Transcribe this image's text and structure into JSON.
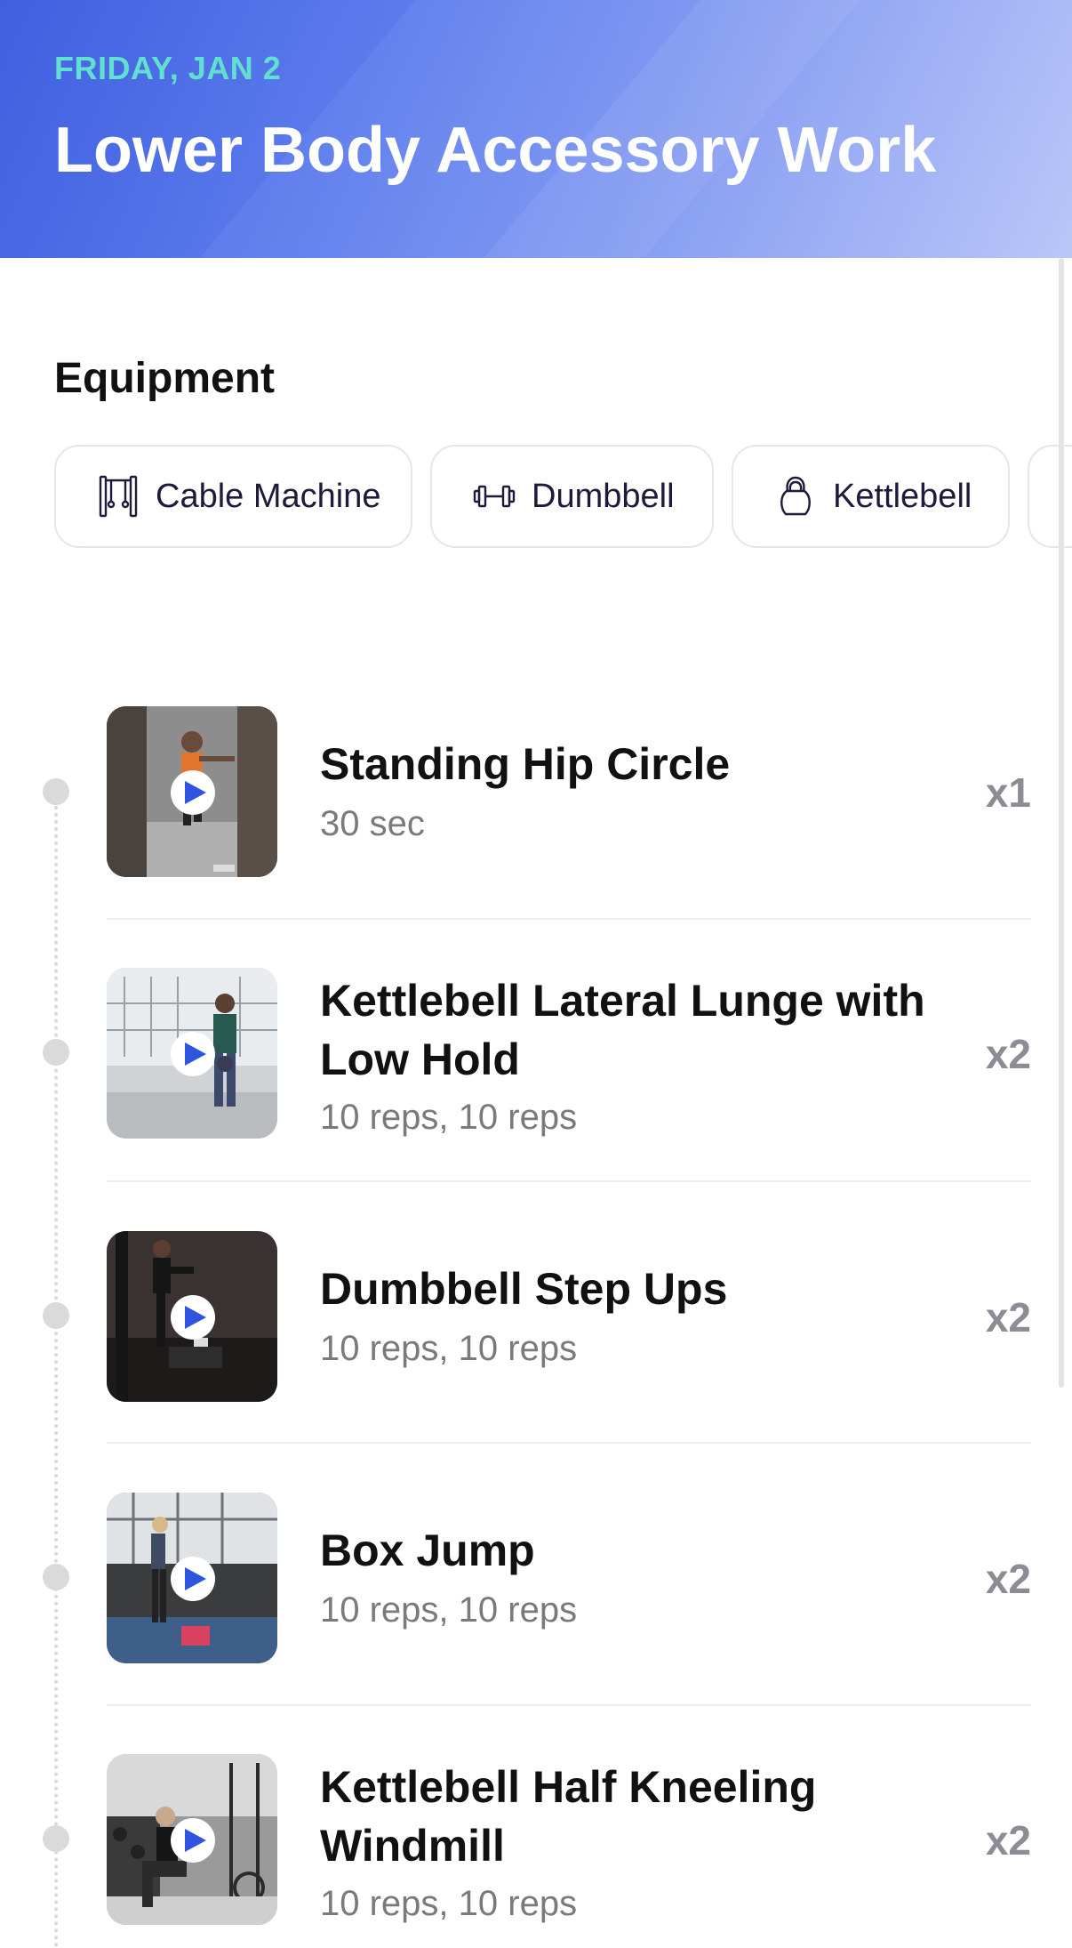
{
  "header": {
    "date": "FRIDAY, JAN 2",
    "title": "Lower Body Accessory Work"
  },
  "equipment": {
    "heading": "Equipment",
    "items": [
      {
        "label": "Cable Machine",
        "icon": "cable-machine-icon"
      },
      {
        "label": "Dumbbell",
        "icon": "dumbbell-icon"
      },
      {
        "label": "Kettlebell",
        "icon": "kettlebell-icon"
      }
    ]
  },
  "exercises": [
    {
      "name": "Standing Hip Circle",
      "detail": "30 sec",
      "count": "x1"
    },
    {
      "name": "Kettlebell Lateral Lunge with Low Hold",
      "detail": "10 reps, 10 reps",
      "count": "x2"
    },
    {
      "name": "Dumbbell Step Ups",
      "detail": "10 reps, 10 reps",
      "count": "x2"
    },
    {
      "name": "Box Jump",
      "detail": "10 reps, 10 reps",
      "count": "x2"
    },
    {
      "name": "Kettlebell Half Kneeling Windmill",
      "detail": "10 reps, 10 reps",
      "count": "x2"
    }
  ],
  "colors": {
    "accent_date": "#62e0cf",
    "play_icon": "#2f55e0",
    "header_gradient_start": "#3f5fe0",
    "header_gradient_end": "#b4c3f8"
  }
}
